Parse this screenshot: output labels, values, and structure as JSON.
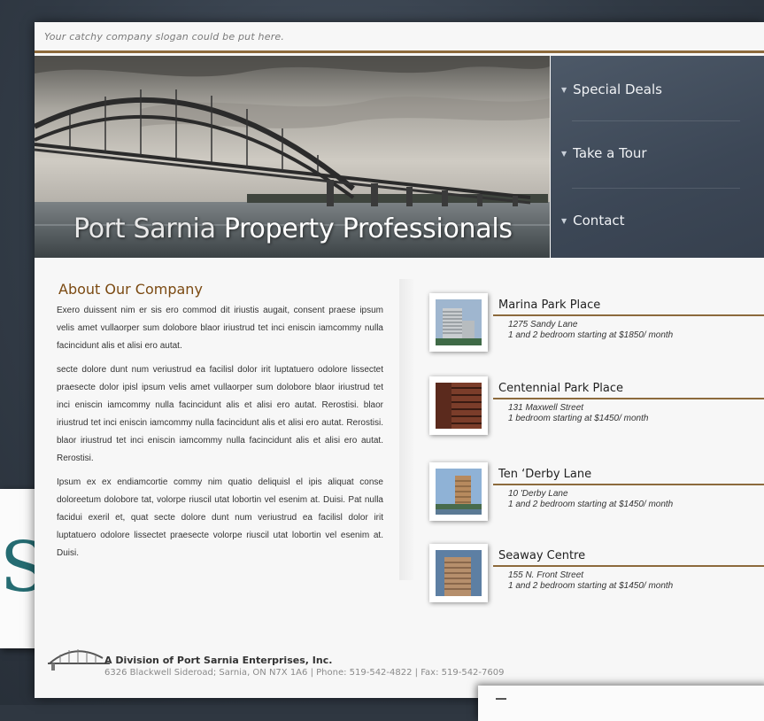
{
  "header": {
    "slogan": "Your catchy company slogan could be put here."
  },
  "hero": {
    "title_part1": "Port Sarnia ",
    "title_part2": "Property Professionals"
  },
  "nav": {
    "items": [
      {
        "label": "Special Deals"
      },
      {
        "label": "Take a Tour"
      },
      {
        "label": "Contact"
      }
    ]
  },
  "about": {
    "title": "About Our Company",
    "paragraphs": [
      "Exero duissent nim er sis ero commod dit iriustis augait, consent praese ipsum velis amet vullaorper sum dolobore blaor iriustrud tet inci eniscin iamcommy nulla facincidunt alis et alisi ero autat.",
      "secte dolore dunt num veriustrud ea facilisl dolor irit luptatuero odolore lissectet praesecte dolor ipisl ipsum velis amet vullaorper sum dolobore blaor iriustrud tet inci eniscin iamcommy nulla facincidunt alis et alisi ero autat. Rerostisi. blaor iriustrud tet inci eniscin iamcommy nulla facincidunt alis et alisi ero autat. Rerostisi. blaor iriustrud tet inci eniscin iamcommy nulla facincidunt alis et alisi ero autat. Rerostisi.",
      "Ipsum ex ex endiamcortie commy nim quatio deliquisl el ipis aliquat conse doloreetum dolobore tat, volorpe riuscil utat lobortin vel esenim at. Duisi. Pat nulla facidui exeril et, quat secte dolore dunt num veriustrud ea facilisl dolor irit luptatuero odolore lissectet praesecte volorpe riuscil utat lobortin vel esenim at. Duisi."
    ]
  },
  "listings": [
    {
      "name": "Marina Park Place",
      "address": "1275 Sandy Lane",
      "description": "1 and 2 bedroom starting at $1850/ month"
    },
    {
      "name": "Centennial Park Place",
      "address": "131 Maxwell Street",
      "description": "1 bedroom starting at $1450/ month"
    },
    {
      "name": "Ten ‘Derby Lane",
      "address": "10 'Derby Lane",
      "description": "1 and 2 bedroom starting at $1450/ month"
    },
    {
      "name": "Seaway Centre",
      "address": "155 N. Front Street",
      "description": "1 and 2 bedroom starting at $1450/ month"
    }
  ],
  "footer": {
    "company": "A Division of Port Sarnia Enterprises, Inc.",
    "contact": "6326 Blackwell Sideroad; Sarnia, ON N7X 1A6 | Phone: 519-542-4822 | Fax: 519-542-7609"
  },
  "side_card": {
    "glyph": "S"
  },
  "colors": {
    "accent_rule": "#8c6a3c",
    "about_title": "#7b4a12",
    "nav_background": "#3c4756"
  },
  "icons": [
    "arrow-bullet-icon",
    "building-photo",
    "bridge-logo-icon"
  ]
}
